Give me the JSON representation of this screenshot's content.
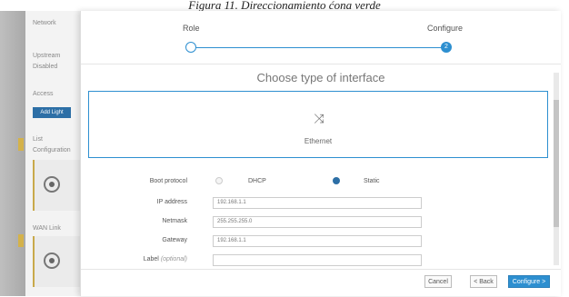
{
  "caption": "Figura 11. Direccionamiento ćona verde",
  "background": {
    "items": [
      {
        "text": "Network"
      },
      {
        "text": "Upstream"
      },
      {
        "text": "Disabled"
      },
      {
        "text": "Access"
      },
      {
        "text": "Add Light"
      },
      {
        "text": "List"
      },
      {
        "text": "Configuration"
      },
      {
        "text": "WAN Link"
      }
    ]
  },
  "wizard": {
    "steps": [
      {
        "label": "Role",
        "state": "done"
      },
      {
        "label": "Configure",
        "state": "active",
        "number": "2"
      }
    ]
  },
  "section_title": "Choose type of interface",
  "interface_option": {
    "label": "Ethernet",
    "icon": "ethernet-icon"
  },
  "form": {
    "boot_protocol_label": "Boot protocol",
    "boot_options": [
      {
        "label": "DHCP",
        "selected": false
      },
      {
        "label": "Static",
        "selected": true
      }
    ],
    "ip_label": "IP address",
    "ip_value": "192.168.1.1",
    "netmask_label": "Netmask",
    "netmask_value": "255.255.255.0",
    "gateway_label": "Gateway",
    "gateway_value": "192.168.1.1",
    "label_label": "Label",
    "label_optional": "(optional)",
    "label_value": ""
  },
  "footer": {
    "cancel": "Cancel",
    "back": "< Back",
    "configure": "Configure >"
  },
  "colors": {
    "accent": "#2d8fd0",
    "primary_button": "#2d8fd0"
  }
}
